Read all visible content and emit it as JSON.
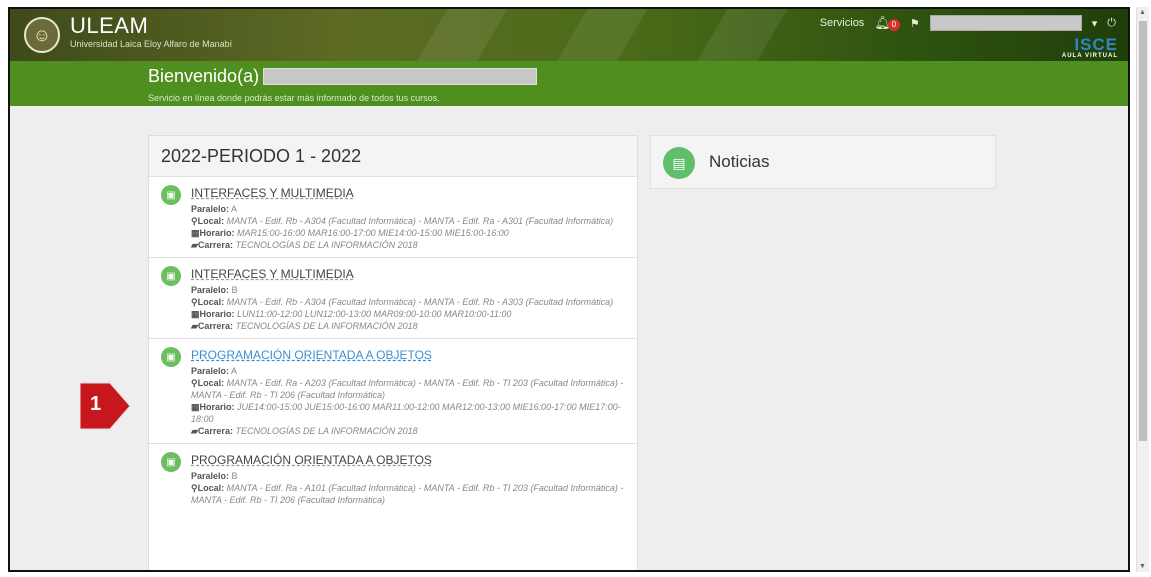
{
  "header": {
    "brand_title": "ULEAM",
    "brand_subtitle": "Universidad Laica Eloy Alfaro de Manabí",
    "services_label": "Servicios",
    "notifications_count": "0",
    "isce_logo": "ISCE",
    "isce_tagline": "AULA VIRTUAL"
  },
  "welcome": {
    "title": "Bienvenido(a)",
    "subtitle": "Servicio en línea donde podrás estar más informado de todos tus cursos."
  },
  "period": {
    "title": "2022-PERIODO 1 - 2022"
  },
  "labels": {
    "paralelo": "Paralelo:",
    "local": "Local:",
    "horario": "Horario:",
    "carrera": "Carrera:"
  },
  "courses": [
    {
      "name": "INTERFACES Y MULTIMEDIA",
      "paralelo": "A",
      "local": "MANTA - Edif. Rb - A304 (Facultad Informática) - MANTA - Edif. Ra - A301 (Facultad Informática)",
      "horario": "MAR15:00-16:00 MAR16:00-17:00 MIE14:00-15:00 MIE15:00-16:00",
      "carrera": "TECNOLOGÍAS DE LA INFORMACIÓN 2018"
    },
    {
      "name": "INTERFACES Y MULTIMEDIA",
      "paralelo": "B",
      "local": "MANTA - Edif. Rb - A304 (Facultad Informática) - MANTA - Edif. Rb - A303 (Facultad Informática)",
      "horario": "LUN11:00-12:00 LUN12:00-13:00 MAR09:00-10:00 MAR10:00-11:00",
      "carrera": "TECNOLOGÍAS DE LA INFORMACIÓN 2018"
    },
    {
      "name": "PROGRAMACIÓN ORIENTADA A OBJETOS",
      "paralelo": "A",
      "local": "MANTA - Edif. Ra - A203 (Facultad Informática) - MANTA - Edif. Rb - TI 203 (Facultad Informática) - MANTA - Edif. Rb - TI 206 (Facultad Informática)",
      "horario": "JUE14:00-15:00 JUE15:00-16:00 MAR11:00-12:00 MAR12:00-13:00 MIE16:00-17:00 MIE17:00-18:00",
      "carrera": "TECNOLOGÍAS DE LA INFORMACIÓN 2018"
    },
    {
      "name": "PROGRAMACIÓN ORIENTADA A OBJETOS",
      "paralelo": "B",
      "local": "MANTA - Edif. Ra - A101 (Facultad Informática) - MANTA - Edif. Rb - TI 203 (Facultad Informática) - MANTA - Edif. Rb - TI 206 (Facultad Informática)"
    }
  ],
  "news": {
    "title": "Noticias"
  },
  "callout": {
    "number": "1"
  },
  "colors": {
    "green_band": "#4f8f1f",
    "link_blue": "#3b8fd0",
    "callout_red": "#c8161d"
  }
}
